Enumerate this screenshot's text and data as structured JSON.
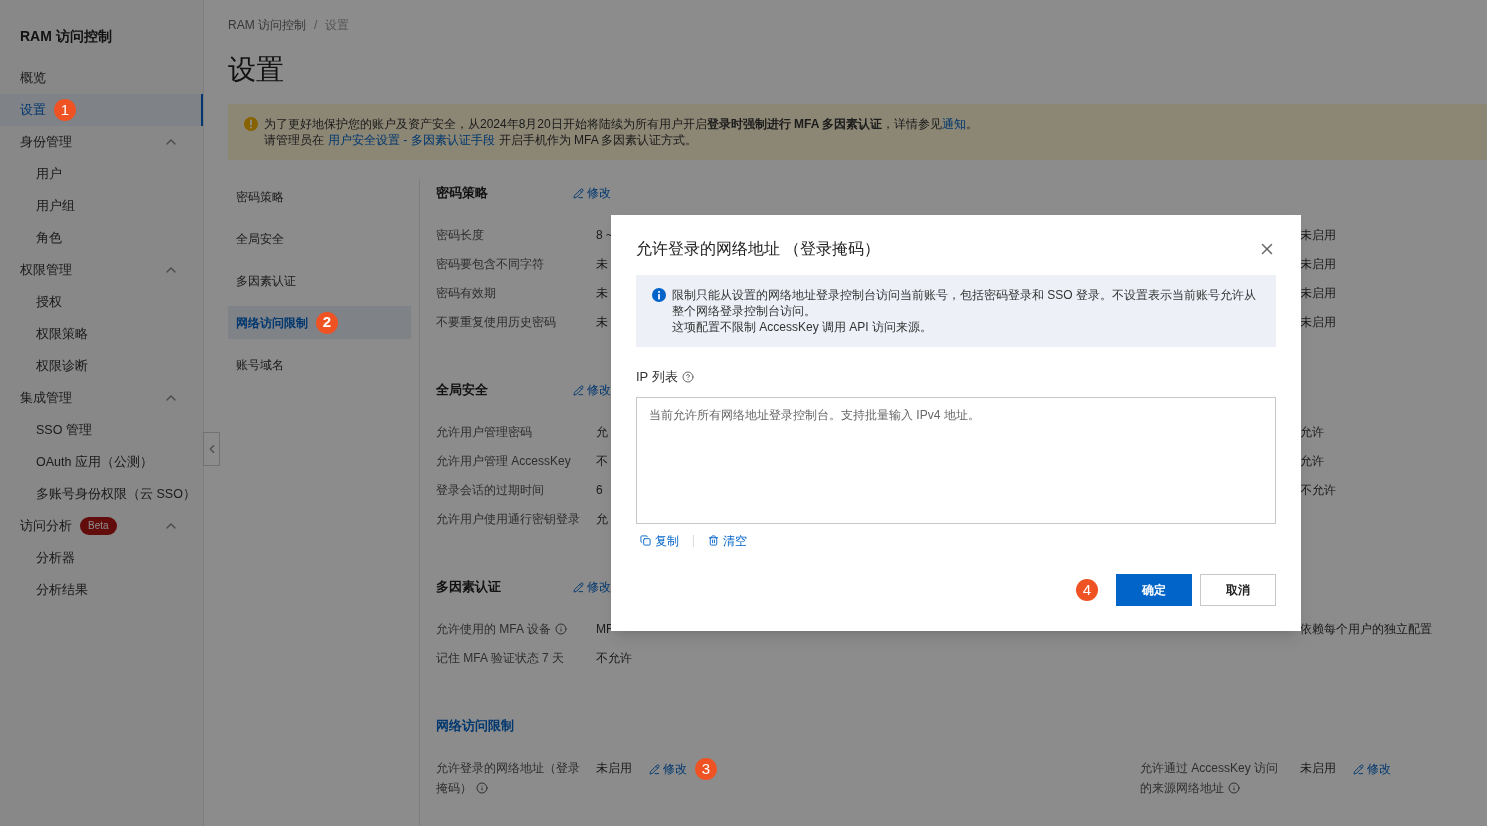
{
  "sidebar": {
    "title": "RAM 访问控制",
    "items": [
      {
        "label": "概览",
        "selected": false
      },
      {
        "label": "设置",
        "selected": true,
        "marker": "1"
      },
      {
        "label": "身份管理",
        "selected": false,
        "expanded": true,
        "children": [
          {
            "label": "用户",
            "selected": false
          },
          {
            "label": "用户组",
            "selected": false
          },
          {
            "label": "角色",
            "selected": false
          }
        ]
      },
      {
        "label": "权限管理",
        "selected": false,
        "expanded": true,
        "children": [
          {
            "label": "授权",
            "selected": false
          },
          {
            "label": "权限策略",
            "selected": false
          },
          {
            "label": "权限诊断",
            "selected": false
          }
        ]
      },
      {
        "label": "集成管理",
        "selected": false,
        "expanded": true,
        "children": [
          {
            "label": "SSO 管理",
            "selected": false
          },
          {
            "label": "OAuth 应用（公测）",
            "selected": false
          },
          {
            "label": "多账号身份权限（云 SSO）",
            "selected": false
          }
        ]
      },
      {
        "label": "访问分析",
        "badge": "Beta",
        "selected": false,
        "expanded": true,
        "children": [
          {
            "label": "分析器",
            "selected": false
          },
          {
            "label": "分析结果",
            "selected": false
          }
        ]
      }
    ]
  },
  "breadcrumb": [
    "RAM 访问控制",
    "设置"
  ],
  "breadcrumb_separator": "/",
  "page_title": "设置",
  "notice": {
    "line1": "为了更好地保护您的账户及资产安全，从2024年8月20日开始将陆续为所有用户开启**登录时强制进行 MFA 多因素认证**，详情参见",
    "line1_link": "通知",
    "line1_end": "。",
    "line2": "请管理员在",
    "line2_link": "用户安全设置 - 多因素认证手段",
    "line2_end": "开启手机作为 MFA 多因素认证方式。"
  },
  "settings_nav": [
    {
      "label": "密码策略",
      "selected": false
    },
    {
      "label": "全局安全",
      "selected": false
    },
    {
      "label": "多因素认证",
      "selected": false
    },
    {
      "label": "网络访问限制",
      "selected": true,
      "marker": "2"
    },
    {
      "label": "账号域名",
      "selected": false
    }
  ],
  "sections": [
    {
      "title": "密码策略",
      "active": false,
      "edit": "修改",
      "rows": [
        {
          "label": "密码长度",
          "info": false,
          "value": "8 ~",
          "right_value": "未启用"
        },
        {
          "label": "密码要包含不同字符",
          "info": false,
          "value": "未",
          "right_value": "未启用"
        },
        {
          "label": "密码有效期",
          "info": false,
          "value": "未",
          "right_value": "未启用"
        },
        {
          "label": "不要重复使用历史密码",
          "info": false,
          "value": "未",
          "right_value": "未启用"
        }
      ]
    },
    {
      "title": "全局安全",
      "active": false,
      "edit": "修改",
      "rows": [
        {
          "label": "允许用户管理密码",
          "info": false,
          "value": "允",
          "right_value": "允许"
        },
        {
          "label": "允许用户管理 AccessKey",
          "info": false,
          "value": "不",
          "right_value": "允许"
        },
        {
          "label": "登录会话的过期时间",
          "info": false,
          "value": "6",
          "right_value": "不允许"
        },
        {
          "label": "允许用户使用通行密钥登录",
          "info": false,
          "value": "允"
        }
      ]
    },
    {
      "title": "多因素认证",
      "active": false,
      "edit": "修改",
      "rows": [
        {
          "label": "允许使用的 MFA 设备",
          "info": true,
          "value": "MF",
          "right_value": "依赖每个用户的独立配置"
        },
        {
          "label": "记住 MFA 验证状态 7 天",
          "info": false,
          "value": "不允许"
        }
      ]
    },
    {
      "title": "网络访问限制",
      "active": true,
      "rows": [
        {
          "label": "允许登录的网络地址（登录掩码）",
          "info": true,
          "value": "未启用",
          "edit": "修改",
          "marker": "3",
          "right_label": "允许通过 AccessKey 访问的来源网络地址",
          "right_info": true,
          "right_value": "未启用",
          "right_edit": "修改"
        }
      ]
    }
  ],
  "dialog": {
    "title": "允许登录的网络地址 （登录掩码）",
    "alert": [
      "限制只能从设置的网络地址登录控制台访问当前账号，包括密码登录和 SSO 登录。不设置表示当前账号允许从整个网络登录控制台访问。",
      "这项配置不限制 AccessKey 调用 API 访问来源。"
    ],
    "field_label": "IP 列表",
    "placeholder": "当前允许所有网络地址登录控制台。支持批量输入 IPv4 地址。",
    "actions": [
      {
        "kind": "copy",
        "label": "复制"
      },
      {
        "kind": "clear",
        "label": "清空"
      }
    ],
    "marker": "4",
    "buttons": [
      {
        "kind": "primary",
        "label": "确定"
      },
      {
        "kind": "default",
        "label": "取消"
      }
    ]
  }
}
